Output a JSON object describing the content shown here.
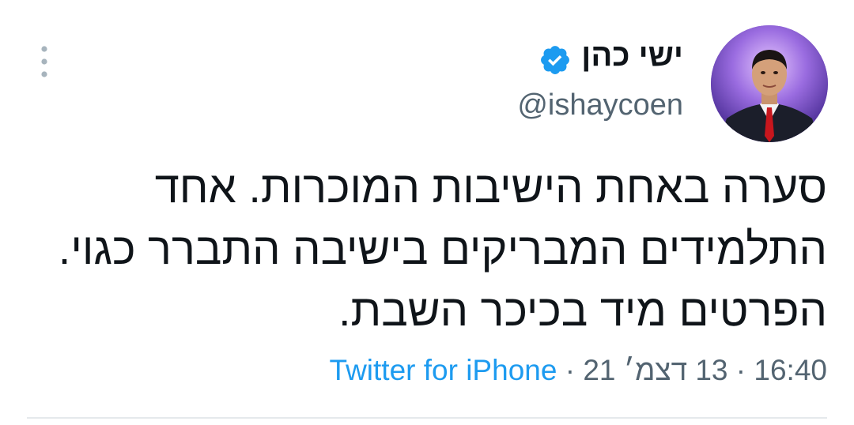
{
  "author": {
    "display_name": "ישי כהן",
    "handle": "@ishaycoen",
    "verified": true
  },
  "tweet": {
    "text": "סערה באחת הישיבות המוכרות. אחד התלמידים המבריקים בישיבה התברר כגוי. הפרטים מיד בכיכר השבת.",
    "time": "16:40",
    "date": "13 דצמ׳ 21",
    "source": "Twitter for iPhone",
    "separator": " · "
  },
  "icons": {
    "verified": "verified-badge-icon",
    "more": "more-vertical-icon"
  },
  "colors": {
    "text": "#0f1419",
    "secondary": "#536471",
    "accent": "#1d9bf0",
    "divider": "#e5e9ec"
  }
}
